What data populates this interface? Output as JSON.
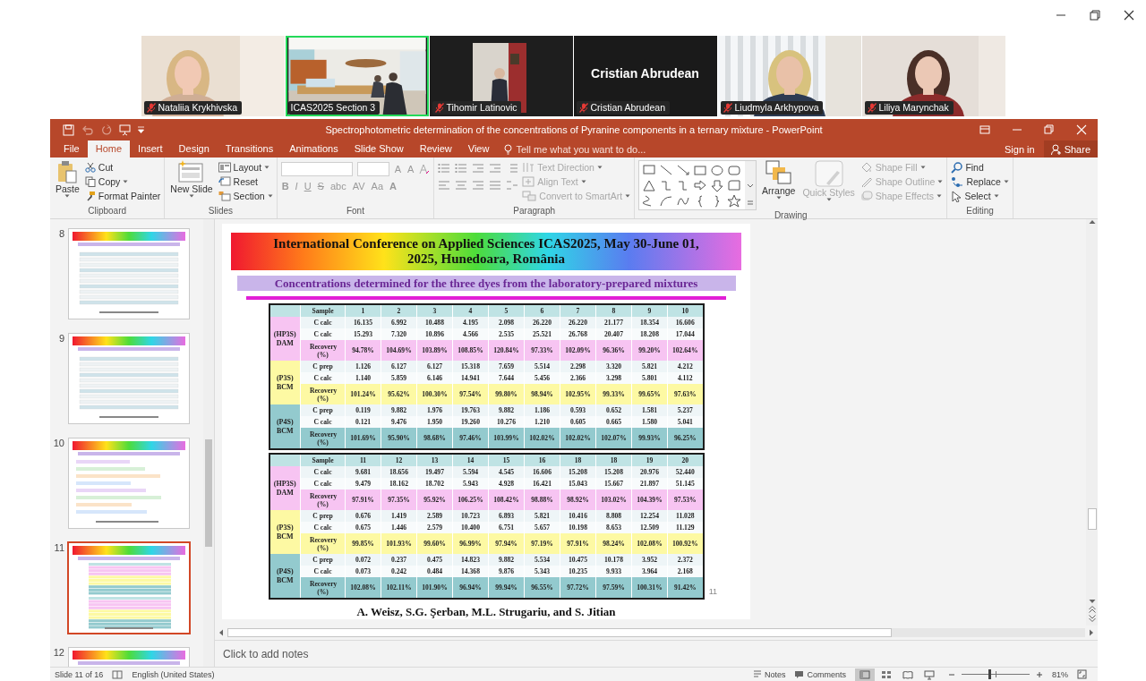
{
  "participants": [
    {
      "name": "Nataliia Krykhivska",
      "kind": "video",
      "muted": true,
      "speaking": false
    },
    {
      "name": "ICAS2025 Section 3",
      "kind": "video",
      "muted": false,
      "speaking": true
    },
    {
      "name": "Tihomir Latinovic",
      "kind": "video",
      "muted": true,
      "speaking": false
    },
    {
      "name": "Cristian Abrudean",
      "kind": "name_only",
      "display_name": "Cristian Abrudean",
      "muted": true,
      "speaking": false
    },
    {
      "name": "Liudmyla Arkhypova",
      "kind": "video",
      "muted": true,
      "speaking": false
    },
    {
      "name": "Liliya Marynchak",
      "kind": "video",
      "muted": true,
      "speaking": false
    }
  ],
  "app": {
    "title": "Spectrophotometric determination of the concentrations of Pyranine components in a ternary mixture - PowerPoint",
    "quick_access": [
      {
        "kind": "save",
        "disabled": false
      },
      {
        "kind": "undo",
        "disabled": true
      },
      {
        "kind": "redo",
        "disabled": true
      },
      {
        "kind": "present",
        "disabled": false
      }
    ],
    "tabs": [
      {
        "label": "File",
        "selected": false
      },
      {
        "label": "Home",
        "selected": true
      },
      {
        "label": "Insert",
        "selected": false
      },
      {
        "label": "Design",
        "selected": false
      },
      {
        "label": "Transitions",
        "selected": false
      },
      {
        "label": "Animations",
        "selected": false
      },
      {
        "label": "Slide Show",
        "selected": false
      },
      {
        "label": "Review",
        "selected": false
      },
      {
        "label": "View",
        "selected": false
      }
    ],
    "tell_me": {
      "placeholder": "Tell me what you want to do..."
    },
    "sign_in": "Sign in",
    "share": "Share"
  },
  "ribbon": {
    "groups": [
      {
        "label": "Clipboard",
        "kind": "clipboard",
        "items": [
          {
            "label": "Paste",
            "disabled": false
          },
          {
            "label": "Cut",
            "disabled": false
          },
          {
            "label": "Copy",
            "disabled": false
          },
          {
            "label": "Format Painter",
            "disabled": false
          }
        ]
      },
      {
        "label": "Slides",
        "kind": "slides",
        "items": [
          {
            "label": "New Slide",
            "disabled": false
          },
          {
            "label": "Layout",
            "disabled": false
          },
          {
            "label": "Reset",
            "disabled": false
          },
          {
            "label": "Section",
            "disabled": false
          }
        ]
      },
      {
        "label": "Font",
        "kind": "font",
        "size_buttons": [
          "A",
          "A"
        ],
        "format_buttons": [
          "B",
          "I",
          "U",
          "S",
          "abc",
          "AV",
          "Aa",
          "A"
        ]
      },
      {
        "label": "Paragraph",
        "kind": "paragraph",
        "items": [
          {
            "label": "Text Direction",
            "disabled": true
          },
          {
            "label": "Align Text",
            "disabled": true
          },
          {
            "label": "Convert to SmartArt",
            "disabled": true
          }
        ]
      },
      {
        "label": "Drawing",
        "kind": "drawing",
        "items": [
          {
            "label": "Arrange",
            "disabled": false
          },
          {
            "label": "Quick Styles",
            "disabled": true
          },
          {
            "label": "Shape Fill",
            "disabled": true
          },
          {
            "label": "Shape Outline",
            "disabled": true
          },
          {
            "label": "Shape Effects",
            "disabled": true
          }
        ]
      },
      {
        "label": "Editing",
        "kind": "editing",
        "items": [
          {
            "label": "Find",
            "disabled": false
          },
          {
            "label": "Replace",
            "disabled": false
          },
          {
            "label": "Select",
            "disabled": false
          }
        ]
      }
    ]
  },
  "slides": [
    {
      "number": "8",
      "selected": false
    },
    {
      "number": "9",
      "selected": false
    },
    {
      "number": "10",
      "selected": false
    },
    {
      "number": "11",
      "selected": true
    },
    {
      "number": "12",
      "selected": false
    }
  ],
  "slide": {
    "title": "International Conference on Applied Sciences ICAS2025, May 30-June 01, 2025, Hunedoara, România",
    "subtitle": "Concentrations determined for the three dyes from the laboratory-prepared mixtures",
    "tables": [
      {
        "columns": [
          "Sample",
          "1",
          "2",
          "3",
          "4",
          "5",
          "6",
          "7",
          "8",
          "9",
          "10"
        ],
        "groups": [
          {
            "label": "(HP3S) DAM",
            "color": "#f7c4f2",
            "rows": [
              {
                "label": "C calc",
                "kind": "value",
                "values": [
                  "16.135",
                  "6.992",
                  "10.488",
                  "4.195",
                  "2.098",
                  "26.220",
                  "26.220",
                  "21.177",
                  "18.354",
                  "16.606"
                ]
              },
              {
                "label": "C calc",
                "kind": "value",
                "values": [
                  "15.293",
                  "7.320",
                  "10.896",
                  "4.566",
                  "2.535",
                  "25.521",
                  "26.768",
                  "20.407",
                  "18.208",
                  "17.044"
                ]
              },
              {
                "label": "Recovery (%)",
                "kind": "recovery",
                "values": [
                  "94.78%",
                  "104.69%",
                  "103.89%",
                  "108.85%",
                  "120.84%",
                  "97.33%",
                  "102.09%",
                  "96.36%",
                  "99.20%",
                  "102.64%"
                ]
              }
            ]
          },
          {
            "label": "(P3S) BCM",
            "color": "#fdf9a3",
            "rows": [
              {
                "label": "C prep",
                "kind": "value",
                "values": [
                  "1.126",
                  "6.127",
                  "6.127",
                  "15.318",
                  "7.659",
                  "5.514",
                  "2.298",
                  "3.320",
                  "5.821",
                  "4.212"
                ]
              },
              {
                "label": "C calc",
                "kind": "value",
                "values": [
                  "1.140",
                  "5.859",
                  "6.146",
                  "14.941",
                  "7.644",
                  "5.456",
                  "2.366",
                  "3.298",
                  "5.801",
                  "4.112"
                ]
              },
              {
                "label": "Recovery (%)",
                "kind": "recovery",
                "values": [
                  "101.24%",
                  "95.62%",
                  "100.30%",
                  "97.54%",
                  "99.80%",
                  "98.94%",
                  "102.95%",
                  "99.33%",
                  "99.65%",
                  "97.63%"
                ]
              }
            ]
          },
          {
            "label": "(P4S) BCM",
            "color": "#93cace",
            "rows": [
              {
                "label": "C prep",
                "kind": "value",
                "values": [
                  "0.119",
                  "9.882",
                  "1.976",
                  "19.763",
                  "9.882",
                  "1.186",
                  "0.593",
                  "0.652",
                  "1.581",
                  "5.237"
                ]
              },
              {
                "label": "C calc",
                "kind": "value",
                "values": [
                  "0.121",
                  "9.476",
                  "1.950",
                  "19.260",
                  "10.276",
                  "1.210",
                  "0.605",
                  "0.665",
                  "1.580",
                  "5.041"
                ]
              },
              {
                "label": "Recovery (%)",
                "kind": "recovery",
                "values": [
                  "101.69%",
                  "95.90%",
                  "98.68%",
                  "97.46%",
                  "103.99%",
                  "102.02%",
                  "102.02%",
                  "102.07%",
                  "99.93%",
                  "96.25%"
                ]
              }
            ]
          }
        ]
      },
      {
        "columns": [
          "Sample",
          "11",
          "12",
          "13",
          "14",
          "15",
          "16",
          "18",
          "18",
          "19",
          "20"
        ],
        "groups": [
          {
            "label": "(HP3S) DAM",
            "color": "#f7c4f2",
            "rows": [
              {
                "label": "C calc",
                "kind": "value",
                "values": [
                  "9.681",
                  "18.656",
                  "19.497",
                  "5.594",
                  "4.545",
                  "16.606",
                  "15.208",
                  "15.208",
                  "20.976",
                  "52.440"
                ]
              },
              {
                "label": "C calc",
                "kind": "value",
                "values": [
                  "9.479",
                  "18.162",
                  "18.702",
                  "5.943",
                  "4.928",
                  "16.421",
                  "15.043",
                  "15.667",
                  "21.897",
                  "51.145"
                ]
              },
              {
                "label": "Recovery (%)",
                "kind": "recovery",
                "values": [
                  "97.91%",
                  "97.35%",
                  "95.92%",
                  "106.25%",
                  "108.42%",
                  "98.88%",
                  "98.92%",
                  "103.02%",
                  "104.39%",
                  "97.53%"
                ]
              }
            ]
          },
          {
            "label": "(P3S) BCM",
            "color": "#fdf9a3",
            "rows": [
              {
                "label": "C prep",
                "kind": "value",
                "values": [
                  "0.676",
                  "1.419",
                  "2.589",
                  "10.723",
                  "6.893",
                  "5.821",
                  "10.416",
                  "8.808",
                  "12.254",
                  "11.028"
                ]
              },
              {
                "label": "C calc",
                "kind": "value",
                "values": [
                  "0.675",
                  "1.446",
                  "2.579",
                  "10.400",
                  "6.751",
                  "5.657",
                  "10.198",
                  "8.653",
                  "12.509",
                  "11.129"
                ]
              },
              {
                "label": "Recovery (%)",
                "kind": "recovery",
                "values": [
                  "99.85%",
                  "101.93%",
                  "99.60%",
                  "96.99%",
                  "97.94%",
                  "97.19%",
                  "97.91%",
                  "98.24%",
                  "102.08%",
                  "100.92%"
                ]
              }
            ]
          },
          {
            "label": "(P4S) BCM",
            "color": "#93cace",
            "rows": [
              {
                "label": "C prep",
                "kind": "value",
                "values": [
                  "0.072",
                  "0.237",
                  "0.475",
                  "14.823",
                  "9.882",
                  "5.534",
                  "10.475",
                  "10.178",
                  "3.952",
                  "2.372"
                ]
              },
              {
                "label": "C calc",
                "kind": "value",
                "values": [
                  "0.073",
                  "0.242",
                  "0.484",
                  "14.368",
                  "9.876",
                  "5.343",
                  "10.235",
                  "9.933",
                  "3.964",
                  "2.168"
                ]
              },
              {
                "label": "Recovery (%)",
                "kind": "recovery",
                "values": [
                  "102.08%",
                  "102.11%",
                  "101.90%",
                  "96.94%",
                  "99.94%",
                  "96.55%",
                  "97.72%",
                  "97.59%",
                  "100.31%",
                  "91.42%"
                ]
              }
            ]
          }
        ]
      }
    ],
    "authors": "A. Weisz, S.G. Şerban, M.L. Strugariu, and S. Jitian",
    "page_number": "11"
  },
  "notes": {
    "placeholder": "Click to add notes"
  },
  "status_bar": {
    "slide": "Slide 11 of 16",
    "language": "English (United States)",
    "notes": "Notes",
    "comments": "Comments",
    "views": [
      {
        "selected": true
      },
      {
        "selected": false
      },
      {
        "selected": false
      },
      {
        "selected": false
      }
    ],
    "zoom_slider": {
      "level": 0.41
    },
    "zoom": "81%"
  }
}
